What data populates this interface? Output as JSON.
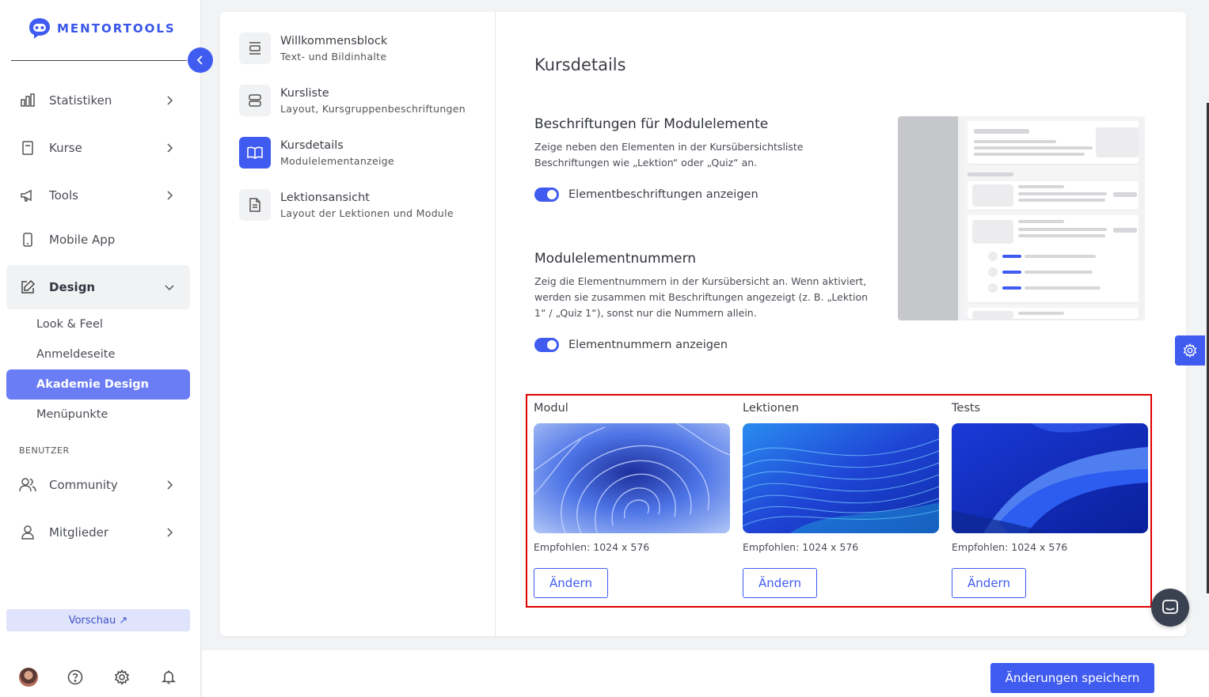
{
  "brand": {
    "name": "MENTORTOOLS",
    "color": "#3f5bf0"
  },
  "sidebar": {
    "items": [
      {
        "label": "Statistiken",
        "icon": "bar-chart-icon"
      },
      {
        "label": "Kurse",
        "icon": "book-icon"
      },
      {
        "label": "Tools",
        "icon": "megaphone-icon"
      },
      {
        "label": "Mobile App",
        "icon": "phone-icon"
      },
      {
        "label": "Design",
        "icon": "edit-icon"
      }
    ],
    "design_sub": [
      "Look & Feel",
      "Anmeldeseite",
      "Akademie Design",
      "Menüpunkte"
    ],
    "active_sub": "Akademie Design",
    "section_label": "BENUTZER",
    "user_items": [
      {
        "label": "Community",
        "icon": "users-icon"
      },
      {
        "label": "Mitglieder",
        "icon": "user-icon"
      }
    ],
    "preview_label": "Vorschau ↗"
  },
  "settings_nav": [
    {
      "title": "Willkommensblock",
      "subtitle": "Text- und Bildinhalte",
      "icon": "layout-block-icon"
    },
    {
      "title": "Kursliste",
      "subtitle": "Layout, Kursgruppenbeschriftungen",
      "icon": "list-layout-icon"
    },
    {
      "title": "Kursdetails",
      "subtitle": "Modulelementanzeige",
      "icon": "open-book-icon"
    },
    {
      "title": "Lektionsansicht",
      "subtitle": "Layout der Lektionen und Module",
      "icon": "document-icon"
    }
  ],
  "content": {
    "title": "Kursdetails",
    "labels_section": {
      "heading": "Beschriftungen für Modulelemente",
      "desc": "Zeige neben den Elementen in der Kursübersichtsliste Beschriftungen wie „Lektion“ oder „Quiz“ an.",
      "toggle_label": "Elementbeschriftungen anzeigen",
      "toggle_on": true
    },
    "numbers_section": {
      "heading": "Modulelementnummern",
      "desc": "Zeig die Elementnummern in der Kursübersicht an. Wenn aktiviert, werden sie zusammen mit Beschriftungen angezeigt (z. B. „Lektion 1“ / „Quiz 1“), sonst nur die Nummern allein.",
      "toggle_label": "Elementnummern anzeigen",
      "toggle_on": true
    },
    "images": [
      {
        "label": "Modul",
        "recommended": "Empfohlen: 1024 x 576",
        "button": "Ändern"
      },
      {
        "label": "Lektionen",
        "recommended": "Empfohlen: 1024 x 576",
        "button": "Ändern"
      },
      {
        "label": "Tests",
        "recommended": "Empfohlen: 1024 x 576",
        "button": "Ändern"
      }
    ]
  },
  "footer": {
    "save_label": "Änderungen speichern"
  }
}
